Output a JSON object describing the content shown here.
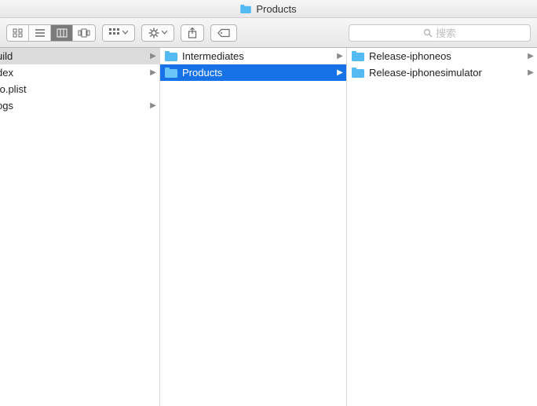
{
  "window": {
    "title": "Products"
  },
  "toolbar": {
    "view_modes": [
      "icon",
      "list",
      "column",
      "coverflow"
    ],
    "active_view": 2
  },
  "search": {
    "placeholder": "搜索"
  },
  "columns": [
    {
      "items": [
        {
          "label": "uild",
          "has_children": true,
          "selected": true,
          "icon": false
        },
        {
          "label": "dex",
          "has_children": true,
          "selected": false,
          "icon": false
        },
        {
          "label": "fo.plist",
          "has_children": false,
          "selected": false,
          "icon": false
        },
        {
          "label": "ogs",
          "has_children": true,
          "selected": false,
          "icon": false
        }
      ]
    },
    {
      "items": [
        {
          "label": "Intermediates",
          "has_children": true,
          "selected": false,
          "icon": true
        },
        {
          "label": "Products",
          "has_children": true,
          "selected": true,
          "icon": true
        }
      ]
    },
    {
      "items": [
        {
          "label": "Release-iphoneos",
          "has_children": true,
          "selected": false,
          "icon": true
        },
        {
          "label": "Release-iphonesimulator",
          "has_children": true,
          "selected": false,
          "icon": true
        }
      ]
    }
  ]
}
